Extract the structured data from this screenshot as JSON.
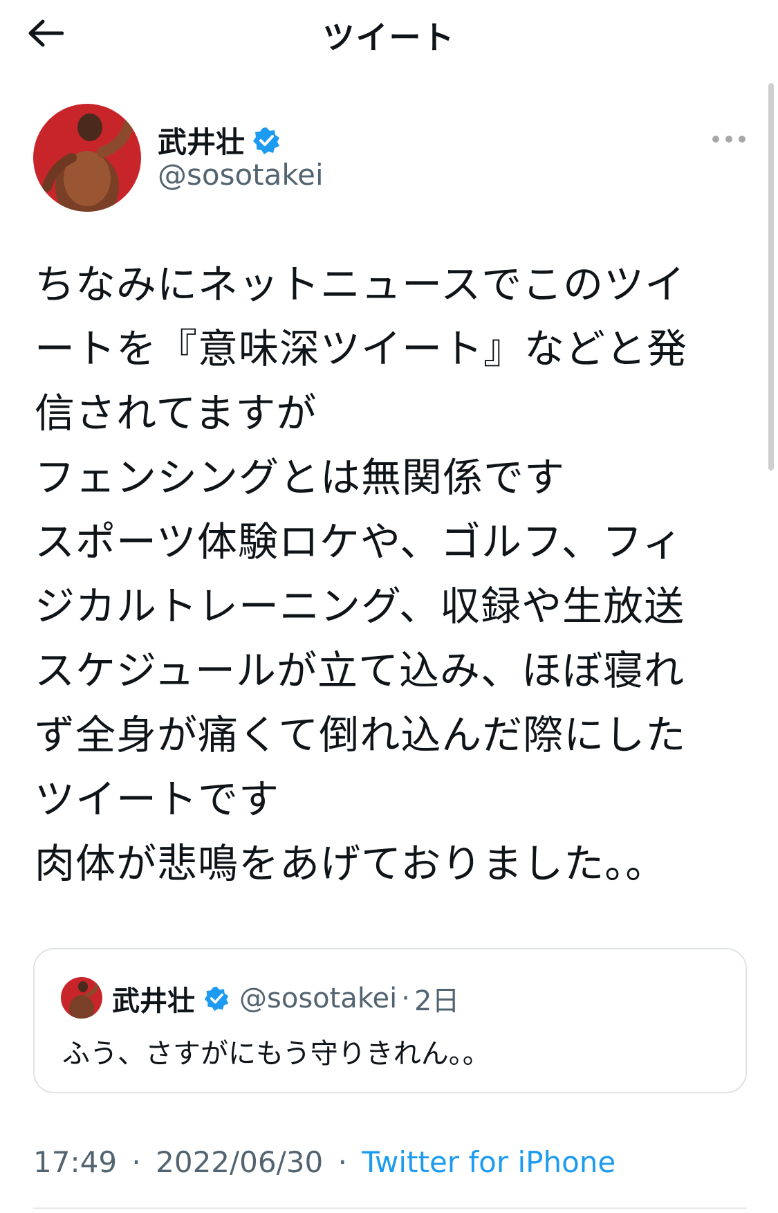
{
  "header": {
    "title": "ツイート"
  },
  "author": {
    "name": "武井壮",
    "handle": "@sosotakei"
  },
  "tweet": {
    "lines": [
      "ちなみにネットニュースでこのツイ",
      "ートを『意味深ツイート』などと発",
      "信されてますが",
      "フェンシングとは無関係です",
      "スポーツ体験ロケや、ゴルフ、フィ",
      "ジカルトレーニング、収録や生放送",
      "スケジュールが立て込み、ほぼ寝れ",
      "ず全身が痛くて倒れ込んだ際にした",
      "ツイートです",
      "肉体が悲鳴をあげておりました。。"
    ]
  },
  "quote": {
    "name": "武井壮",
    "handle": "@sosotakei",
    "time": "2日",
    "text": "ふう、さすがにもう守りきれん。。"
  },
  "meta": {
    "time": "17:49",
    "date": "2022/06/30",
    "app": "Twitter for iPhone",
    "separator": "·"
  },
  "colors": {
    "accent": "#1d9bf0",
    "muted": "#536471",
    "avatar_bg": "#c8252b"
  },
  "icons": {
    "back": "arrow-left-icon",
    "verified": "verified-badge-icon",
    "more": "more-horizontal-icon"
  }
}
